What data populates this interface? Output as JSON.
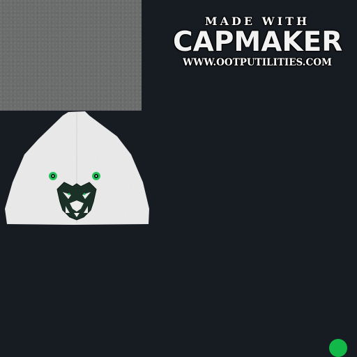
{
  "watermark": {
    "line1": "MADE WITH",
    "line2": "CAPMAKER",
    "line3": "WWW.OOTPUTILITIES.COM"
  },
  "colors": {
    "background": "#171c22",
    "crown_fill": "#ececec",
    "swatch_gray": "#6b6d6c",
    "logo_dark": "#1b3026",
    "eye_green": "#22c25a",
    "dot_green": "#13b948"
  },
  "icons": {
    "logo": "tiger-head-icon",
    "indicator": "green-dot-icon"
  }
}
